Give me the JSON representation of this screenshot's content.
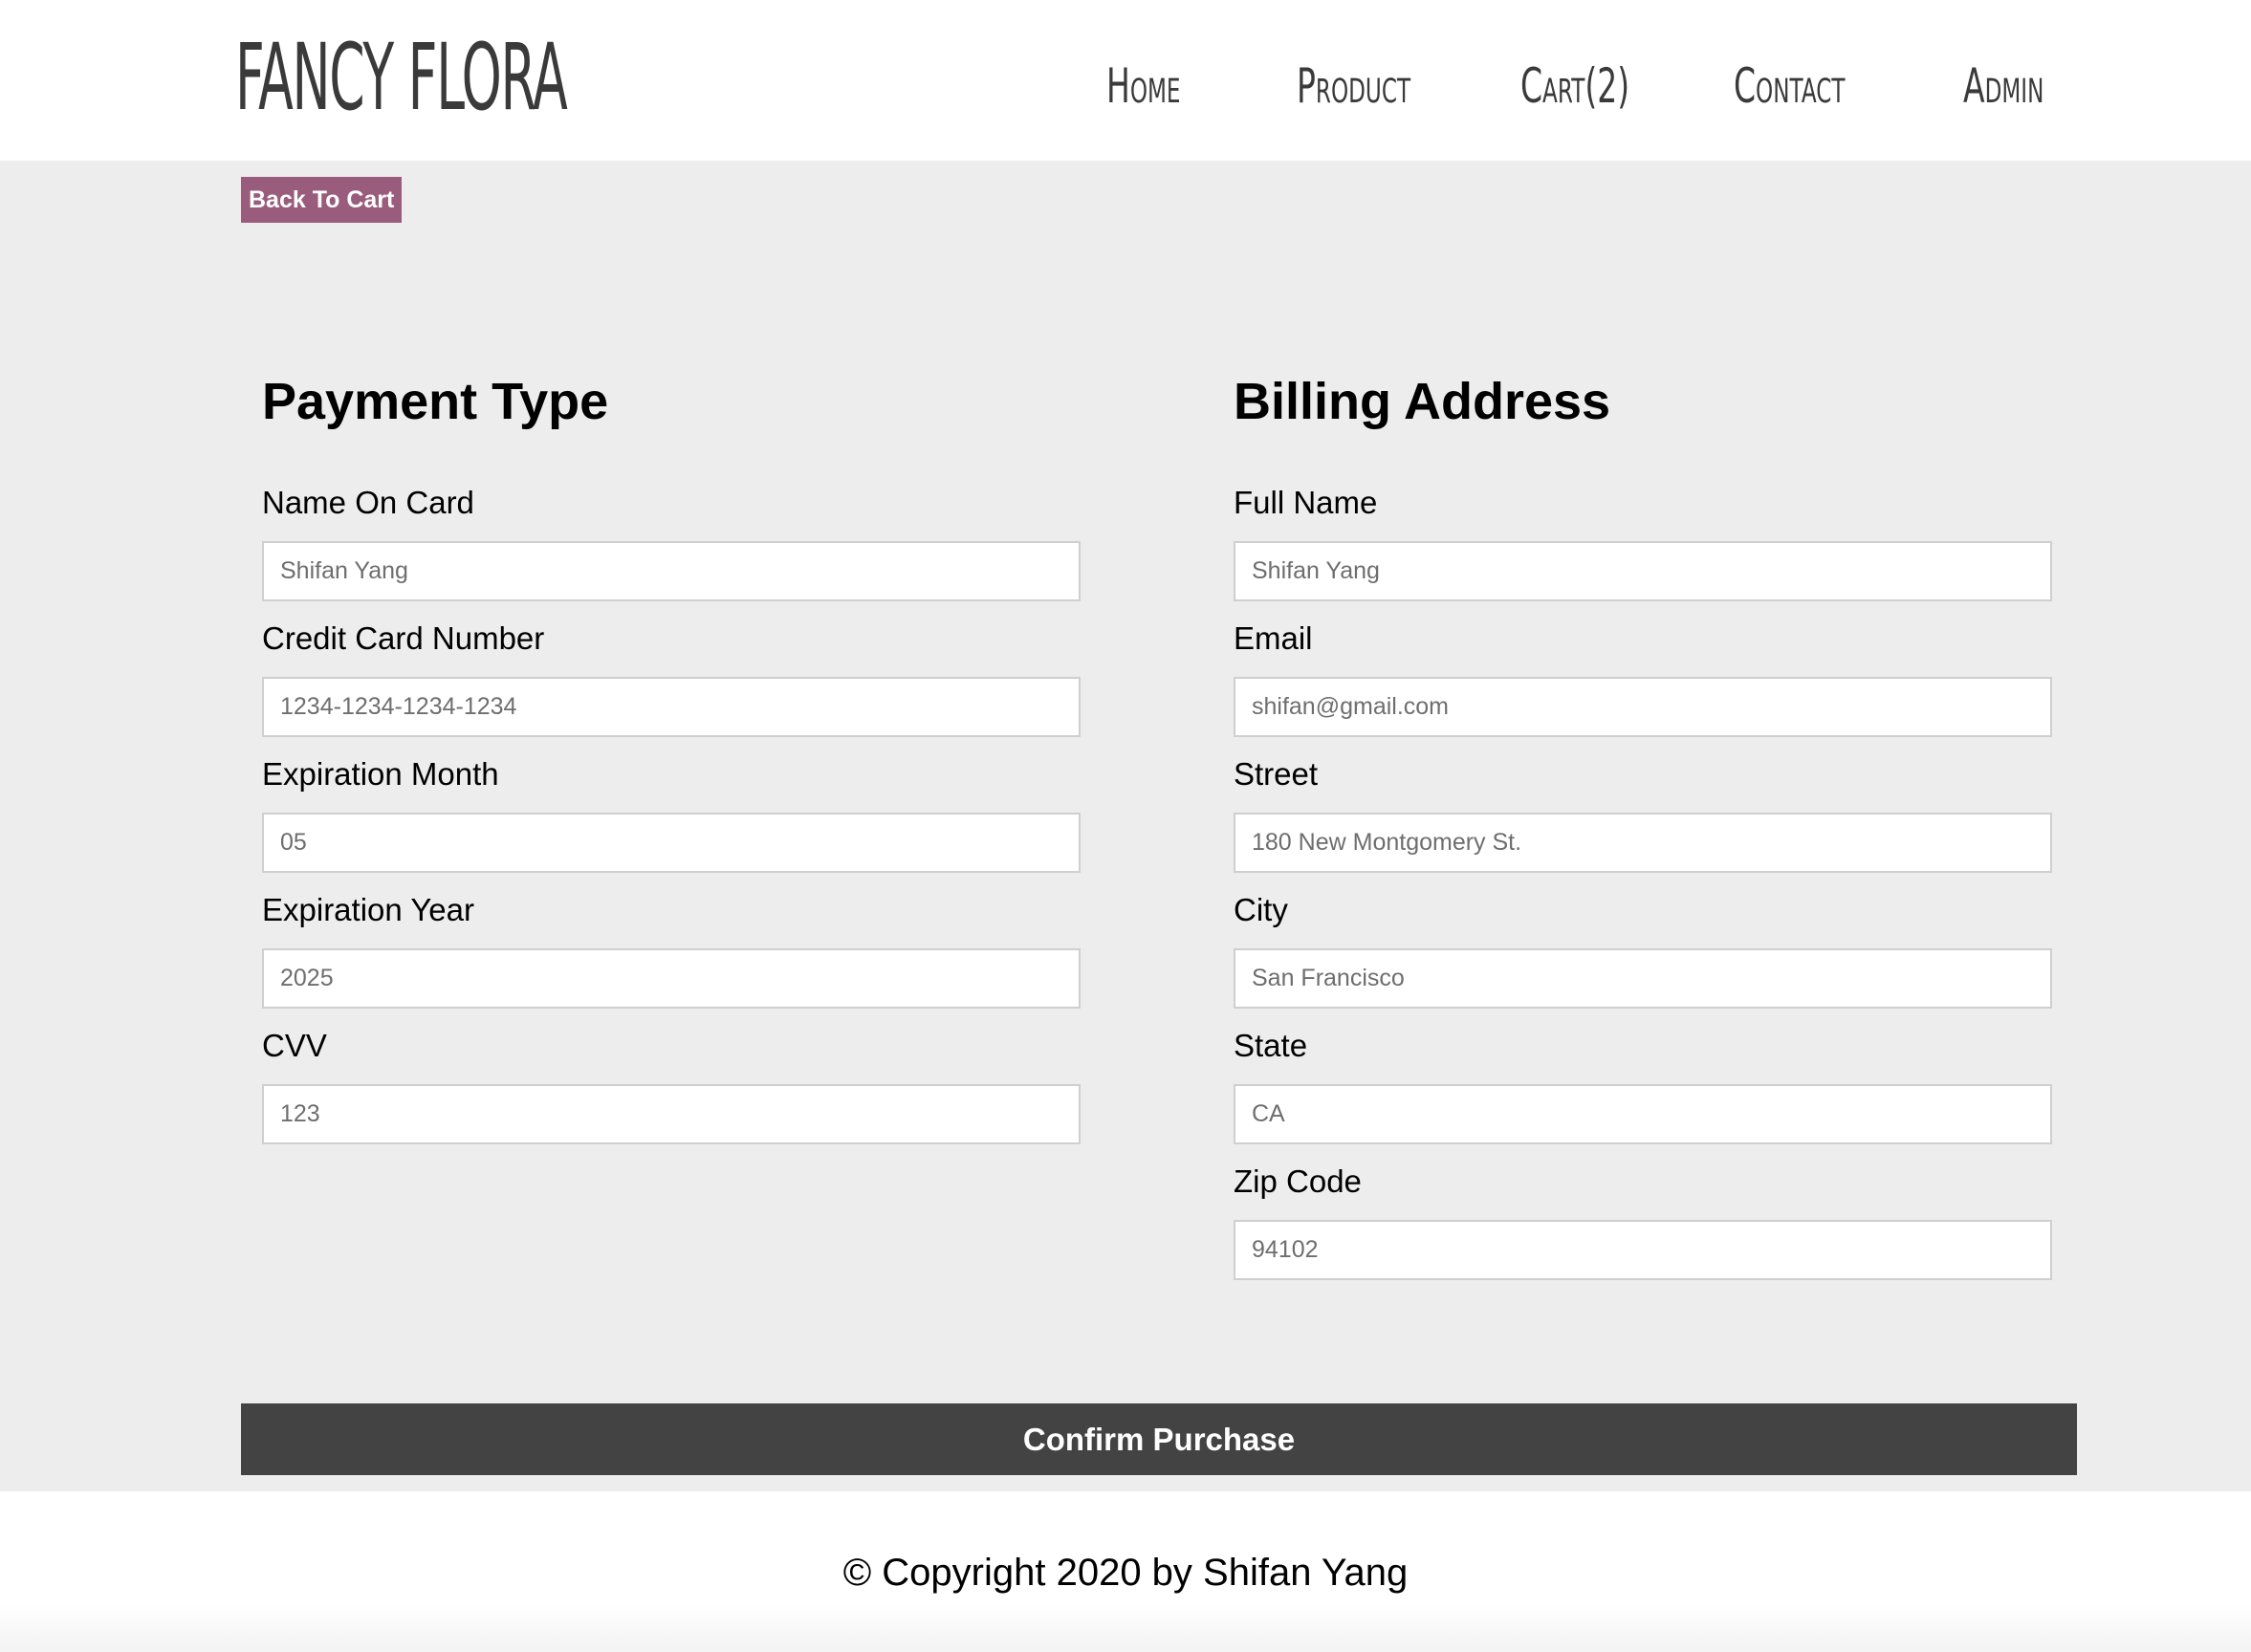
{
  "header": {
    "logo": "FANCY FLORA",
    "nav": [
      {
        "label": "Home"
      },
      {
        "label": "Product"
      },
      {
        "label": "Cart(2)"
      },
      {
        "label": "Contact"
      },
      {
        "label": "Admin"
      }
    ]
  },
  "back_button": "Back To Cart",
  "payment": {
    "title": "Payment Type",
    "fields": [
      {
        "label": "Name On Card",
        "placeholder": "Shifan Yang"
      },
      {
        "label": "Credit Card Number",
        "placeholder": "1234-1234-1234-1234"
      },
      {
        "label": "Expiration Month",
        "placeholder": "05"
      },
      {
        "label": "Expiration Year",
        "placeholder": "2025"
      },
      {
        "label": "CVV",
        "placeholder": "123"
      }
    ]
  },
  "billing": {
    "title": "Billing Address",
    "fields": [
      {
        "label": "Full Name",
        "placeholder": "Shifan Yang"
      },
      {
        "label": "Email",
        "placeholder": "shifan@gmail.com"
      },
      {
        "label": "Street",
        "placeholder": "180 New Montgomery St."
      },
      {
        "label": "City",
        "placeholder": "San Francisco"
      },
      {
        "label": "State",
        "placeholder": "CA"
      },
      {
        "label": "Zip Code",
        "placeholder": "94102"
      }
    ]
  },
  "confirm_button": "Confirm Purchase",
  "footer": {
    "copyright": "© Copyright 2020 by Shifan Yang"
  },
  "colors": {
    "accent": "#9a5c7d",
    "confirm_bg": "#434343",
    "page_bg": "#ededed"
  }
}
